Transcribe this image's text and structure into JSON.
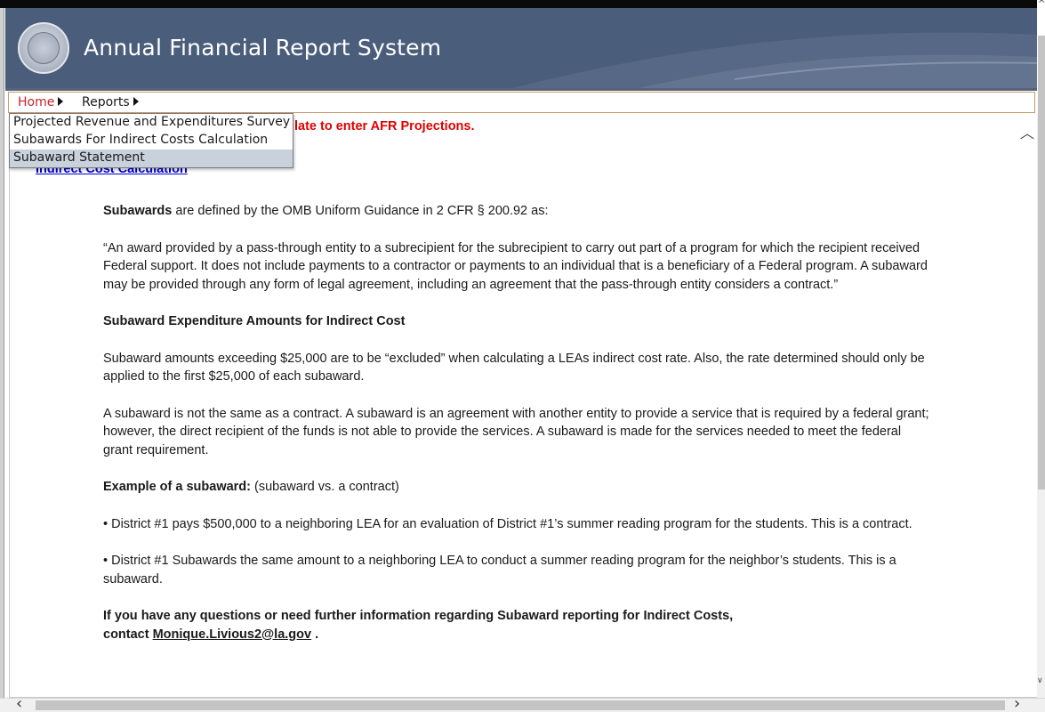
{
  "header": {
    "title": "Annual Financial Report System"
  },
  "menu": {
    "home": "Home",
    "reports": "Reports"
  },
  "dropdown": {
    "items": [
      {
        "label": "Projected Revenue and Expenditures Survey"
      },
      {
        "label": "Subawards For Indirect Costs Calculation"
      },
      {
        "label": "Subaward Statement",
        "selected": true
      }
    ]
  },
  "main": {
    "notice_visible_fragment": "late to enter AFR Projections.",
    "link_heading_visible_fragment": "Indirect Cost Calculation",
    "definition_intro_bold": "Subawards",
    "definition_intro_rest": " are defined by the OMB Uniform Guidance in 2 CFR § 200.92 as:",
    "definition_quote": "“An award provided by a pass-through entity to a subrecipient for the subrecipient to carry out part of a program for which the recipient received Federal support. It does not include payments to a contractor or payments to an individual that is a beneficiary of a Federal program. A subaward may be provided through any form of legal agreement, including an agreement that the pass-through entity considers a contract.”",
    "amounts_heading": "Subaward Expenditure Amounts for Indirect Cost",
    "amounts_text": "Subaward amounts exceeding $25,000 are to be “excluded” when calculating a LEAs indirect cost rate. Also, the rate determined should only be applied to the first $25,000 of each subaward.",
    "contract_text": "A subaward is not the same as a contract. A subaward is an agreement with another entity to provide a service that is required by a federal grant; however, the direct recipient of the funds is not able to provide the services. A subaward is made for the services needed to meet the federal grant requirement.",
    "example_bold": "Example of a subaward:",
    "example_rest": " (subaward vs. a contract)",
    "bullet1": "• District #1 pays $500,000 to a neighboring LEA for an evaluation of District #1’s summer reading program for the students. This is a contract.",
    "bullet2": "• District #1 Subawards the same amount to a neighboring LEA to conduct a summer reading program for the neighbor’s students. This is a subaward.",
    "questions_text": "If you have any questions or need further information regarding Subaward reporting for Indirect Costs,",
    "contact_prefix": "contact ",
    "contact_email": "Monique.Livious2@la.gov",
    "contact_suffix": " ."
  },
  "colors": {
    "header_bg": "#4a5d7b",
    "notice_red": "#e00000",
    "link_blue": "#0000cc",
    "home_red": "#c0272d",
    "dropdown_selected": "#c8d1dc"
  },
  "icons": {
    "seal": "state-seal-icon",
    "menu_arrow": "triangle-right-icon",
    "scroll_up": "chevron-up-icon",
    "scroll_left": "chevron-left-icon",
    "scroll_right": "chevron-right-icon"
  }
}
